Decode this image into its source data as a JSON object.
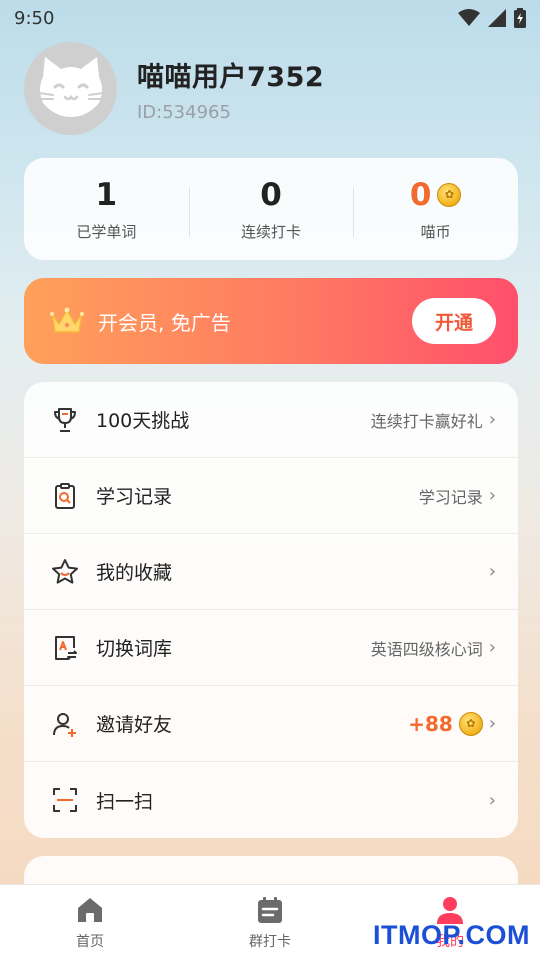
{
  "status_bar": {
    "time": "9:50"
  },
  "profile": {
    "username": "喵喵用户7352",
    "user_id": "ID:534965"
  },
  "stats": [
    {
      "value": "1",
      "label": "已学单词"
    },
    {
      "value": "0",
      "label": "连续打卡"
    },
    {
      "value": "0",
      "label": "喵币"
    }
  ],
  "vip": {
    "text": "开会员, 免广告",
    "button": "开通"
  },
  "menu": [
    {
      "label": "100天挑战",
      "extra": "连续打卡赢好礼",
      "icon": "trophy-icon"
    },
    {
      "label": "学习记录",
      "extra": "学习记录",
      "icon": "clipboard-search-icon"
    },
    {
      "label": "我的收藏",
      "extra": "",
      "icon": "star-icon"
    },
    {
      "label": "切换词库",
      "extra": "英语四级核心词",
      "icon": "book-switch-icon"
    },
    {
      "label": "邀请好友",
      "extra": "+88",
      "icon": "add-user-icon"
    },
    {
      "label": "扫一扫",
      "extra": "",
      "icon": "scan-icon"
    }
  ],
  "tabs": [
    {
      "label": "首页",
      "icon": "home-icon"
    },
    {
      "label": "群打卡",
      "icon": "calendar-icon"
    },
    {
      "label": "我的",
      "icon": "profile-icon"
    }
  ],
  "watermark": "ITMOP.COM",
  "colors": {
    "accent_orange": "#f26a2e",
    "accent_pink": "#ff3e5e",
    "vip_gradient_start": "#ffa05a",
    "vip_gradient_end": "#ff4f6b"
  }
}
